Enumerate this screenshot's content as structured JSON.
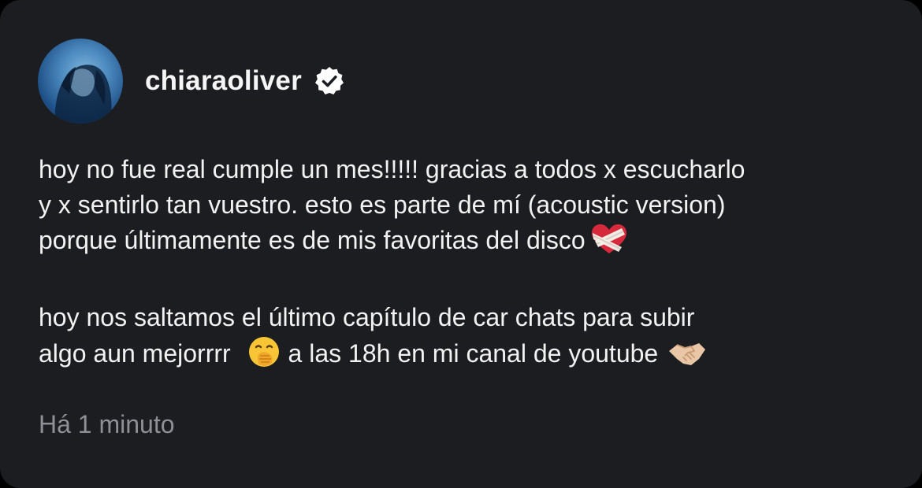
{
  "post": {
    "author": {
      "username": "chiaraoliver",
      "verified": true
    },
    "paragraphs": [
      {
        "lines": [
          "hoy no fue real cumple un mes!!!!! gracias a todos x escucharlo",
          "y x sentirlo tan vuestro. esto es parte de mí (acoustic version)",
          "porque últimamente es de mis favoritas del disco"
        ],
        "trailing_emoji": "heart-with-bandage-icon"
      },
      {
        "lines": [
          "hoy nos saltamos el último capítulo de car chats para subir",
          "algo aun mejorrrr",
          "a las 18h en mi canal de youtube"
        ],
        "inline_emojis": [
          "face-with-hand-over-mouth-icon",
          "handshake-icon"
        ]
      }
    ],
    "timestamp": "Há 1 minuto"
  },
  "colors": {
    "card_background": "#1c1d21",
    "text": "#f2f2f2",
    "timestamp": "#8e9096",
    "verified_badge": "#ffffff"
  }
}
